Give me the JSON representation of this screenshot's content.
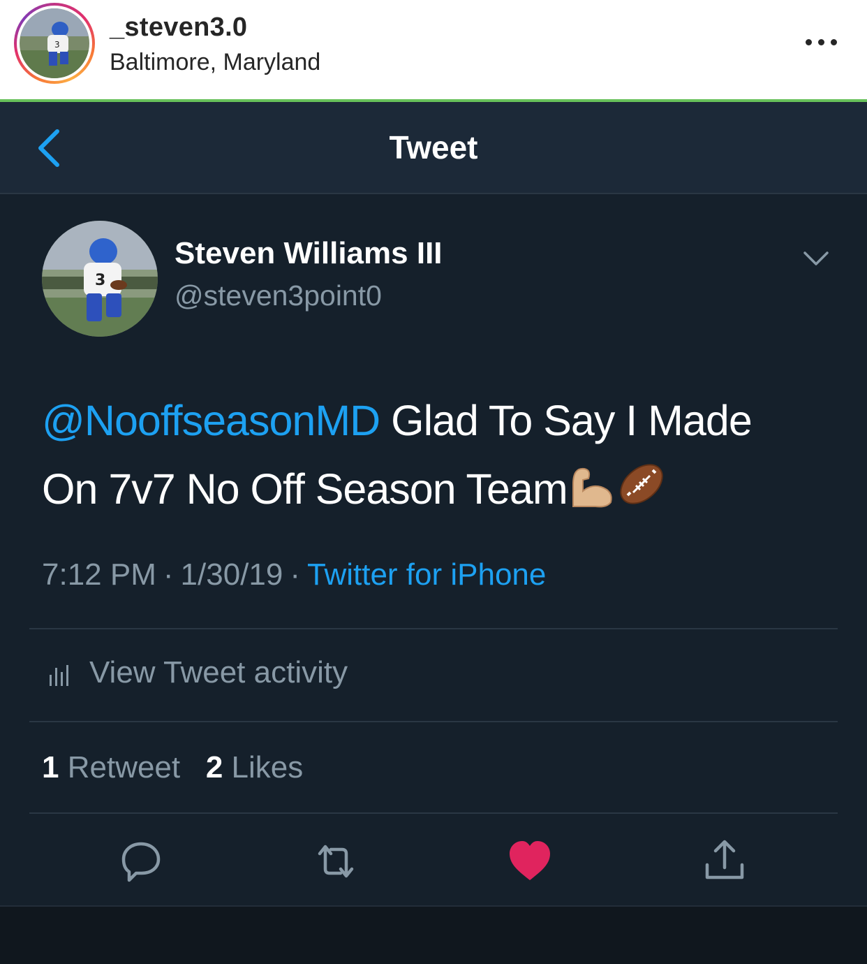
{
  "instagram": {
    "username": "_steven3.0",
    "location": "Baltimore, Maryland"
  },
  "nav": {
    "title": "Tweet"
  },
  "tweet": {
    "display_name": "Steven Williams III",
    "handle": "@steven3point0",
    "mention": "@NooffseasonMD",
    "text_line1": " Glad To Say I Made",
    "text_line2": "On 7v7 No Off Season Team",
    "time": "7:12 PM",
    "date": "1/30/19",
    "source": "Twitter for iPhone",
    "activity_label": "View Tweet activity",
    "retweet_count": "1",
    "retweet_label": "Retweet",
    "like_count": "2",
    "like_label": "Likes"
  },
  "icons": {
    "reply": "reply-icon",
    "retweet": "retweet-icon",
    "like": "heart-icon",
    "share": "share-icon",
    "emoji_1": "flexed-biceps-emoji",
    "emoji_2": "american-football-emoji"
  },
  "colors": {
    "background": "#15202b",
    "nav_background": "#1c2938",
    "accent": "#1da1f2",
    "secondary_text": "#8899a6",
    "like": "#e0245e",
    "divider_green": "#68c15b"
  }
}
